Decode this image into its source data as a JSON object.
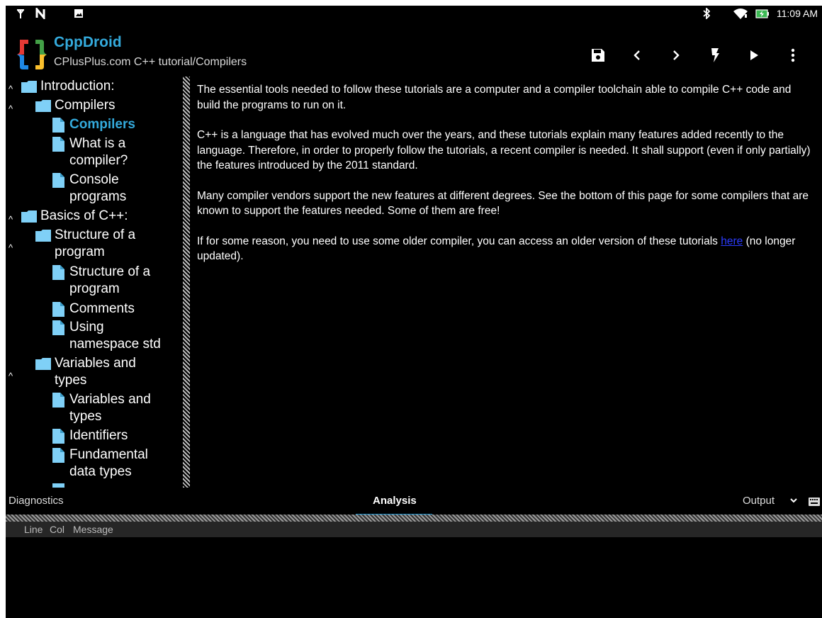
{
  "status_bar": {
    "time": "11:09 AM",
    "icons": [
      "antenna-icon",
      "n-icon",
      "moon-icon",
      "image-icon",
      "bluetooth-icon",
      "moon-icon",
      "wifi-icon",
      "battery-charging-icon"
    ]
  },
  "app": {
    "title": "CppDroid",
    "subtitle": "CPlusPlus.com C++ tutorial/Compilers",
    "accent_color": "#34aadc"
  },
  "toolbar": [
    "save-icon",
    "back-icon",
    "forward-icon",
    "build-icon",
    "run-icon",
    "more-icon"
  ],
  "tree": {
    "items": [
      {
        "label": "Introduction:",
        "type": "folder"
      },
      {
        "label": "Compilers",
        "type": "folder"
      },
      {
        "label": "Compilers",
        "type": "doc",
        "active": true
      },
      {
        "label1": "What is a",
        "label2": "compiler?",
        "type": "doc"
      },
      {
        "label1": "Console",
        "label2": "programs",
        "type": "doc"
      },
      {
        "label": "Basics of C++:",
        "type": "folder"
      },
      {
        "label1": "Structure of a",
        "label2": "program",
        "type": "folder"
      },
      {
        "label1": "Structure of a",
        "label2": "program",
        "type": "doc"
      },
      {
        "label": "Comments",
        "type": "doc"
      },
      {
        "label1": "Using",
        "label2": "namespace std",
        "type": "doc"
      },
      {
        "label1": "Variables and",
        "label2": "types",
        "type": "folder"
      },
      {
        "label1": "Variables and",
        "label2": "types",
        "type": "doc"
      },
      {
        "label": "Identifiers",
        "type": "doc"
      },
      {
        "label1": "Fundamental",
        "label2": "data types",
        "type": "doc"
      }
    ]
  },
  "content": {
    "p1": "The essential tools needed to follow these tutorials are a computer and a compiler toolchain able to compile C++ code and build the programs to run on it.",
    "p2": "C++ is a language that has evolved much over the years, and these tutorials explain many features added recently to the language. Therefore, in order to properly follow the tutorials, a recent compiler is needed. It shall support (even if only partially) the features introduced by the 2011 standard.",
    "p3": "Many compiler vendors support the new features at different degrees. See the bottom of this page for some compilers that are known to support the features needed. Some of them are free!",
    "p4": "If for some reason, you need to use some older compiler, you can access an older version of these tutorials",
    "link": "here",
    "p4_tail": " (no longer updated)."
  },
  "tabs": {
    "diagnostics": "Diagnostics",
    "analysis": "Analysis",
    "output": "Output"
  },
  "diagnostics_header": {
    "line": "Line",
    "col": "Col",
    "message": "Message"
  }
}
